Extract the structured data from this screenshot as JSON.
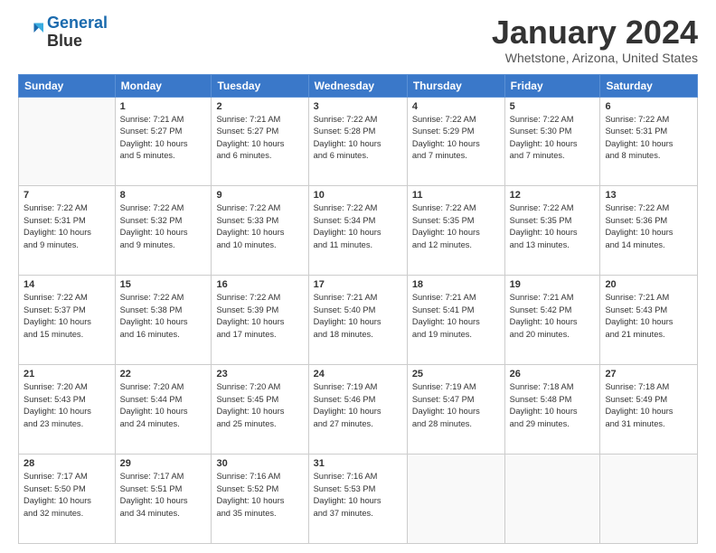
{
  "header": {
    "logo_line1": "General",
    "logo_line2": "Blue",
    "month": "January 2024",
    "location": "Whetstone, Arizona, United States"
  },
  "days_of_week": [
    "Sunday",
    "Monday",
    "Tuesday",
    "Wednesday",
    "Thursday",
    "Friday",
    "Saturday"
  ],
  "weeks": [
    [
      {
        "day": "",
        "info": ""
      },
      {
        "day": "1",
        "info": "Sunrise: 7:21 AM\nSunset: 5:27 PM\nDaylight: 10 hours\nand 5 minutes."
      },
      {
        "day": "2",
        "info": "Sunrise: 7:21 AM\nSunset: 5:27 PM\nDaylight: 10 hours\nand 6 minutes."
      },
      {
        "day": "3",
        "info": "Sunrise: 7:22 AM\nSunset: 5:28 PM\nDaylight: 10 hours\nand 6 minutes."
      },
      {
        "day": "4",
        "info": "Sunrise: 7:22 AM\nSunset: 5:29 PM\nDaylight: 10 hours\nand 7 minutes."
      },
      {
        "day": "5",
        "info": "Sunrise: 7:22 AM\nSunset: 5:30 PM\nDaylight: 10 hours\nand 7 minutes."
      },
      {
        "day": "6",
        "info": "Sunrise: 7:22 AM\nSunset: 5:31 PM\nDaylight: 10 hours\nand 8 minutes."
      }
    ],
    [
      {
        "day": "7",
        "info": "Sunrise: 7:22 AM\nSunset: 5:31 PM\nDaylight: 10 hours\nand 9 minutes."
      },
      {
        "day": "8",
        "info": "Sunrise: 7:22 AM\nSunset: 5:32 PM\nDaylight: 10 hours\nand 9 minutes."
      },
      {
        "day": "9",
        "info": "Sunrise: 7:22 AM\nSunset: 5:33 PM\nDaylight: 10 hours\nand 10 minutes."
      },
      {
        "day": "10",
        "info": "Sunrise: 7:22 AM\nSunset: 5:34 PM\nDaylight: 10 hours\nand 11 minutes."
      },
      {
        "day": "11",
        "info": "Sunrise: 7:22 AM\nSunset: 5:35 PM\nDaylight: 10 hours\nand 12 minutes."
      },
      {
        "day": "12",
        "info": "Sunrise: 7:22 AM\nSunset: 5:35 PM\nDaylight: 10 hours\nand 13 minutes."
      },
      {
        "day": "13",
        "info": "Sunrise: 7:22 AM\nSunset: 5:36 PM\nDaylight: 10 hours\nand 14 minutes."
      }
    ],
    [
      {
        "day": "14",
        "info": "Sunrise: 7:22 AM\nSunset: 5:37 PM\nDaylight: 10 hours\nand 15 minutes."
      },
      {
        "day": "15",
        "info": "Sunrise: 7:22 AM\nSunset: 5:38 PM\nDaylight: 10 hours\nand 16 minutes."
      },
      {
        "day": "16",
        "info": "Sunrise: 7:22 AM\nSunset: 5:39 PM\nDaylight: 10 hours\nand 17 minutes."
      },
      {
        "day": "17",
        "info": "Sunrise: 7:21 AM\nSunset: 5:40 PM\nDaylight: 10 hours\nand 18 minutes."
      },
      {
        "day": "18",
        "info": "Sunrise: 7:21 AM\nSunset: 5:41 PM\nDaylight: 10 hours\nand 19 minutes."
      },
      {
        "day": "19",
        "info": "Sunrise: 7:21 AM\nSunset: 5:42 PM\nDaylight: 10 hours\nand 20 minutes."
      },
      {
        "day": "20",
        "info": "Sunrise: 7:21 AM\nSunset: 5:43 PM\nDaylight: 10 hours\nand 21 minutes."
      }
    ],
    [
      {
        "day": "21",
        "info": "Sunrise: 7:20 AM\nSunset: 5:43 PM\nDaylight: 10 hours\nand 23 minutes."
      },
      {
        "day": "22",
        "info": "Sunrise: 7:20 AM\nSunset: 5:44 PM\nDaylight: 10 hours\nand 24 minutes."
      },
      {
        "day": "23",
        "info": "Sunrise: 7:20 AM\nSunset: 5:45 PM\nDaylight: 10 hours\nand 25 minutes."
      },
      {
        "day": "24",
        "info": "Sunrise: 7:19 AM\nSunset: 5:46 PM\nDaylight: 10 hours\nand 27 minutes."
      },
      {
        "day": "25",
        "info": "Sunrise: 7:19 AM\nSunset: 5:47 PM\nDaylight: 10 hours\nand 28 minutes."
      },
      {
        "day": "26",
        "info": "Sunrise: 7:18 AM\nSunset: 5:48 PM\nDaylight: 10 hours\nand 29 minutes."
      },
      {
        "day": "27",
        "info": "Sunrise: 7:18 AM\nSunset: 5:49 PM\nDaylight: 10 hours\nand 31 minutes."
      }
    ],
    [
      {
        "day": "28",
        "info": "Sunrise: 7:17 AM\nSunset: 5:50 PM\nDaylight: 10 hours\nand 32 minutes."
      },
      {
        "day": "29",
        "info": "Sunrise: 7:17 AM\nSunset: 5:51 PM\nDaylight: 10 hours\nand 34 minutes."
      },
      {
        "day": "30",
        "info": "Sunrise: 7:16 AM\nSunset: 5:52 PM\nDaylight: 10 hours\nand 35 minutes."
      },
      {
        "day": "31",
        "info": "Sunrise: 7:16 AM\nSunset: 5:53 PM\nDaylight: 10 hours\nand 37 minutes."
      },
      {
        "day": "",
        "info": ""
      },
      {
        "day": "",
        "info": ""
      },
      {
        "day": "",
        "info": ""
      }
    ]
  ]
}
